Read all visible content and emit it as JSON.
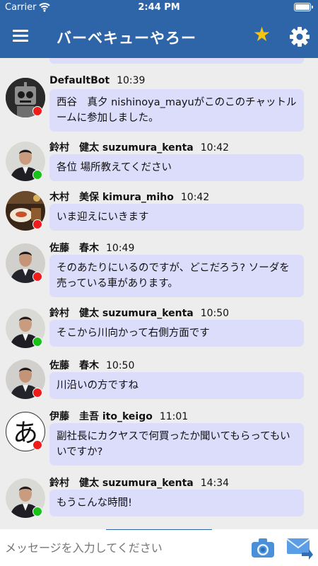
{
  "status_bar": {
    "carrier": "Carrier",
    "time": "2:44 PM"
  },
  "header": {
    "title": "バーベキューやろー",
    "menu_icon": "hamburger-menu-icon",
    "favorite_icon": "star-icon",
    "settings_icon": "gear-icon",
    "favorite_color": "#f6c413",
    "bar_color": "#2e64a8"
  },
  "messages": [
    {
      "name": "DefaultBot",
      "time": "10:39",
      "text": "西谷　真夕 nishinoya_mayuがこのこのチャットルームに参加しました。",
      "status": "offline",
      "avatar": "robot"
    },
    {
      "name": "鈴村　健太 suzumura_kenta",
      "time": "10:42",
      "text": "各位 場所教えてください",
      "status": "online",
      "avatar": "person"
    },
    {
      "name": "木村　美保 kimura_miho",
      "time": "10:42",
      "text": "いま迎えにいきます",
      "status": "offline",
      "avatar": "food"
    },
    {
      "name": "佐藤　春木",
      "time": "10:49",
      "text": "そのあたりにいるのですが、どこだろう? ソーダを売っている車があります。",
      "status": "offline",
      "avatar": "person"
    },
    {
      "name": "鈴村　健太 suzumura_kenta",
      "time": "10:50",
      "text": "そこから川向かって右側方面です",
      "status": "online",
      "avatar": "person"
    },
    {
      "name": "佐藤　春木",
      "time": "10:50",
      "text": "川沿いの方ですね",
      "status": "offline",
      "avatar": "person"
    },
    {
      "name": "伊藤　圭吾 ito_keigo",
      "time": "11:01",
      "text": "副社長にカクヤスで何買ったか聞いてもらってもいいですか?",
      "status": "offline",
      "avatar": "letter",
      "avatar_letter": "あ"
    },
    {
      "name": "鈴村　健太 suzumura_kenta",
      "time": "14:34",
      "text": "もうこんな時間!",
      "status": "online",
      "avatar": "person"
    }
  ],
  "input": {
    "placeholder": "メッセージを入力してください",
    "camera_icon": "camera-icon",
    "send_icon": "send-mail-icon"
  },
  "colors": {
    "bubble": "#dcdcfb",
    "online": "#19c219",
    "offline": "#ef1c1c",
    "chat_background": "#ededed"
  }
}
